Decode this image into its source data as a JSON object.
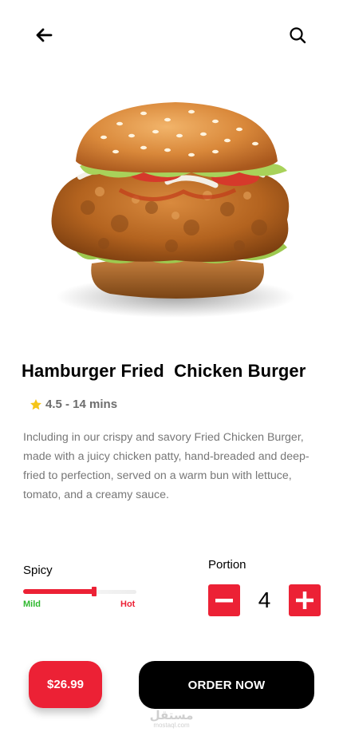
{
  "header": {
    "back_icon": "arrow-left-icon",
    "search_icon": "search-icon"
  },
  "product": {
    "image_icon": "fried-chicken-burger-image",
    "title": "Hamburger Fried  Chicken Burger",
    "rating_icon": "star-icon",
    "rating_text": "4.5 - 14 mins",
    "description": "Including in our crispy and savory Fried Chicken Burger, made with a juicy chicken patty, hand-breaded and deep-fried to perfection, served on a warm bun with lettuce, tomato, and a creamy sauce."
  },
  "spicy": {
    "label": "Spicy",
    "min_label": "Mild",
    "max_label": "Hot",
    "level": 0.63,
    "colors": {
      "fill": "#ec2135",
      "mild": "#2eb82e",
      "hot": "#ec2135"
    }
  },
  "portion": {
    "label": "Portion",
    "quantity": "4",
    "minus_icon": "minus-icon",
    "plus_icon": "plus-icon"
  },
  "footer": {
    "price": "$26.99",
    "order_label": "ORDER NOW"
  },
  "watermark": {
    "arabic": "مستقل",
    "latin": "mostaql.com"
  },
  "colors": {
    "accent": "#ec2135",
    "primary_button": "#000000",
    "star": "#f5c518"
  }
}
